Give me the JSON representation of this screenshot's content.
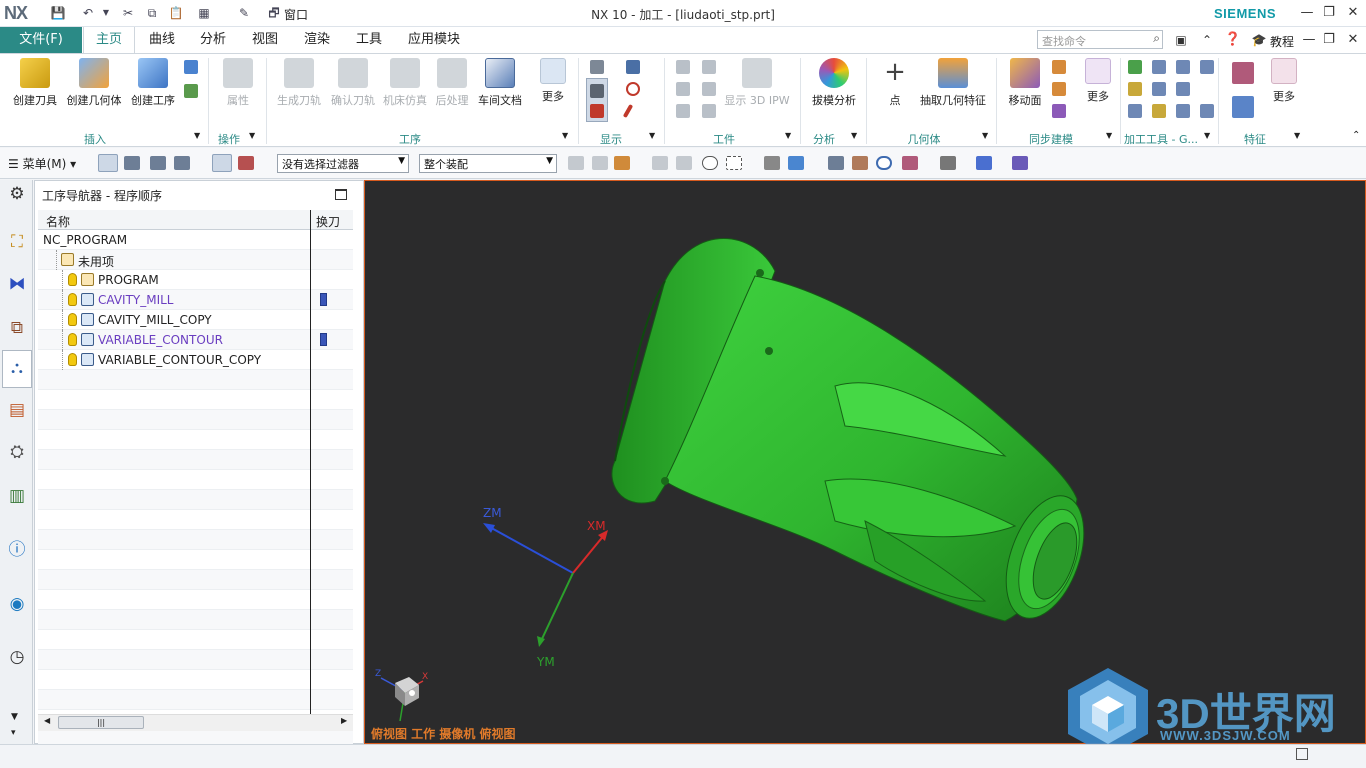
{
  "window": {
    "logo": "NX",
    "title": "NX 10 - 加工 - [liudaoti_stp.prt]",
    "brand": "SIEMENS",
    "window_menu": "窗口"
  },
  "tabs": {
    "file": "文件(F)",
    "items": [
      "主页",
      "曲线",
      "分析",
      "视图",
      "渲染",
      "工具",
      "应用模块"
    ],
    "active": "主页"
  },
  "search": {
    "placeholder": "查找命令"
  },
  "help": {
    "tutorial": "教程"
  },
  "ribbon": {
    "insert": {
      "create_tool": "创建刀具",
      "create_geometry": "创建几何体",
      "create_operation": "创建工序",
      "group": "插入"
    },
    "operation": {
      "properties": "属性",
      "group": "操作"
    },
    "process": {
      "generate_path": "生成刀轨",
      "verify_path": "确认刀轨",
      "machine_sim": "机床仿真",
      "post_process": "后处理",
      "shop_doc": "车间文档",
      "more": "更多",
      "group": "工序"
    },
    "display": {
      "group": "显示"
    },
    "workpiece": {
      "show_ipw": "显示 3D IPW",
      "group": "工件"
    },
    "analysis": {
      "draft": "拔模分析",
      "group": "分析"
    },
    "geometry": {
      "point": "点",
      "extract": "抽取几何特征",
      "group": "几何体"
    },
    "sync": {
      "move_face": "移动面",
      "more": "更多",
      "group": "同步建模"
    },
    "machining_tools": {
      "group": "加工工具 - G..."
    },
    "feature": {
      "more": "更多",
      "group": "特征"
    }
  },
  "toolbar": {
    "menu": "菜单(M)",
    "filter": "没有选择过滤器",
    "assembly": "整个装配"
  },
  "navigator": {
    "title": "工序导航器 - 程序顺序",
    "col_name": "名称",
    "col_tool": "换刀",
    "rows": [
      {
        "label": "NC_PROGRAM",
        "color": "#222222"
      },
      {
        "label": "未用项",
        "color": "#222222"
      },
      {
        "label": "PROGRAM",
        "color": "#222222"
      },
      {
        "label": "CAVITY_MILL",
        "color": "#6a3ec0"
      },
      {
        "label": "CAVITY_MILL_COPY",
        "color": "#222222"
      },
      {
        "label": "VARIABLE_CONTOUR",
        "color": "#6a3ec0"
      },
      {
        "label": "VARIABLE_CONTOUR_COPY",
        "color": "#222222"
      }
    ]
  },
  "graphics": {
    "axes": {
      "zm": "ZM",
      "xm": "XM",
      "ym": "YM"
    },
    "triad": {
      "z": "Z",
      "x": "X"
    },
    "view_label": "俯视图 工作 摄像机 俯视图",
    "model_color": "#2fb52f"
  },
  "watermark": {
    "text": "3D世界网",
    "url": "WWW.3DSJW.COM"
  }
}
